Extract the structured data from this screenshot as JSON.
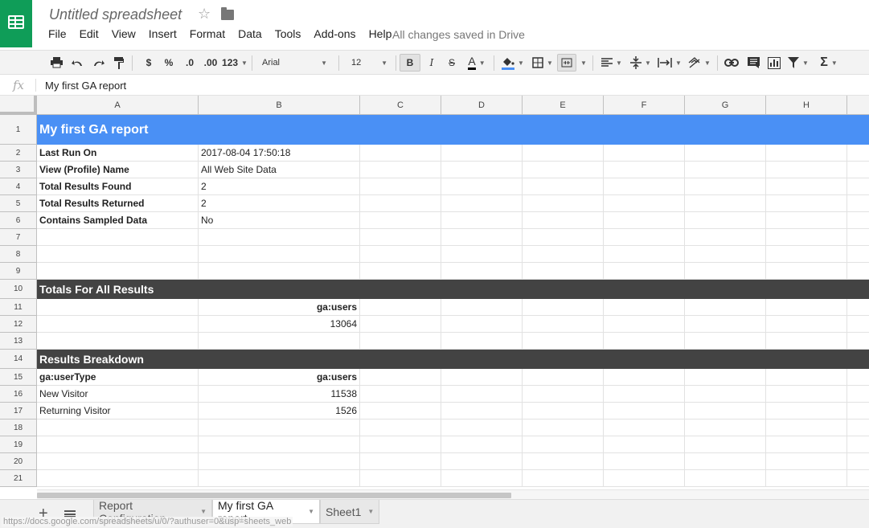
{
  "header": {
    "title": "Untitled spreadsheet",
    "save_status": "All changes saved in Drive",
    "menu": [
      "File",
      "Edit",
      "View",
      "Insert",
      "Format",
      "Data",
      "Tools",
      "Add-ons",
      "Help"
    ]
  },
  "toolbar": {
    "currency": "$",
    "percent": "%",
    "decrease_decimal": ".0",
    "increase_decimal": ".00",
    "number_format": "123",
    "font": "Arial",
    "font_size": "12",
    "bold": "B",
    "italic": "I",
    "strikethrough": "S",
    "text_color": "A",
    "sum": "Σ"
  },
  "formula_bar": {
    "fx": "fx",
    "content": "My first GA report"
  },
  "columns": [
    "A",
    "B",
    "C",
    "D",
    "E",
    "F",
    "G",
    "H"
  ],
  "rows": [
    {
      "num": "1",
      "band": "blue",
      "text": "My first GA report"
    },
    {
      "num": "2",
      "a": "Last Run On",
      "a_bold": true,
      "b": "2017-08-04 17:50:18"
    },
    {
      "num": "3",
      "a": "View (Profile) Name",
      "a_bold": true,
      "b": "All Web Site Data"
    },
    {
      "num": "4",
      "a": "Total Results Found",
      "a_bold": true,
      "b": "2"
    },
    {
      "num": "5",
      "a": "Total Results Returned",
      "a_bold": true,
      "b": "2"
    },
    {
      "num": "6",
      "a": "Contains Sampled Data",
      "a_bold": true,
      "b": "No"
    },
    {
      "num": "7"
    },
    {
      "num": "8"
    },
    {
      "num": "9"
    },
    {
      "num": "10",
      "band": "dark",
      "text": "Totals For All Results"
    },
    {
      "num": "11",
      "b": "ga:users",
      "b_bold": true,
      "b_right": true
    },
    {
      "num": "12",
      "b": "13064",
      "b_right": true
    },
    {
      "num": "13"
    },
    {
      "num": "14",
      "band": "dark",
      "text": "Results Breakdown"
    },
    {
      "num": "15",
      "a": "ga:userType",
      "a_bold": true,
      "b": "ga:users",
      "b_bold": true,
      "b_right": true
    },
    {
      "num": "16",
      "a": "New Visitor",
      "b": "11538",
      "b_right": true
    },
    {
      "num": "17",
      "a": "Returning Visitor",
      "b": "1526",
      "b_right": true
    },
    {
      "num": "18"
    },
    {
      "num": "19"
    },
    {
      "num": "20"
    },
    {
      "num": "21"
    }
  ],
  "sheets": [
    {
      "name": "Report Configuration",
      "active": false
    },
    {
      "name": "My first GA report",
      "active": true
    },
    {
      "name": "Sheet1",
      "active": false
    }
  ],
  "status_url": "https://docs.google.com/spreadsheets/u/0/?authuser=0&usp=sheets_web",
  "colors": {
    "brand": "#0f9d58",
    "title_band": "#4a90f5",
    "section_band": "#434343"
  }
}
